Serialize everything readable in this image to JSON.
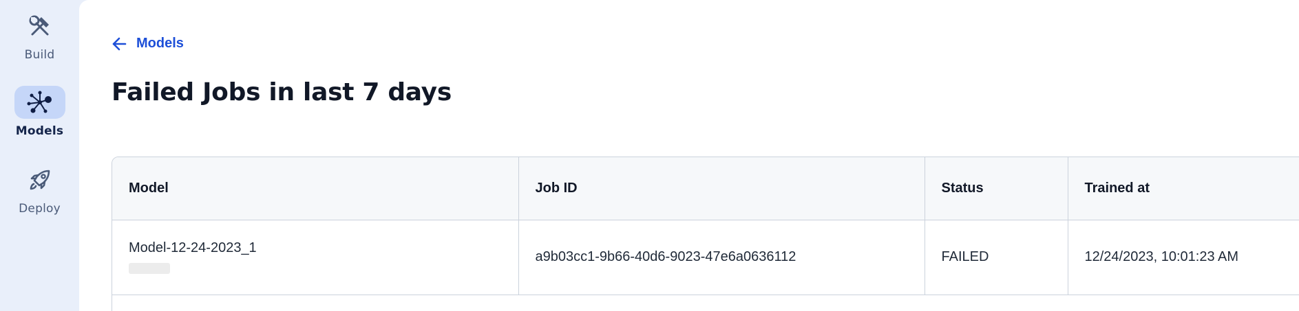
{
  "sidebar": {
    "items": [
      {
        "label": "Build",
        "icon": "hammer-wrench-icon",
        "active": false
      },
      {
        "label": "Models",
        "icon": "network-graph-icon",
        "active": true
      },
      {
        "label": "Deploy",
        "icon": "rocket-icon",
        "active": false
      }
    ]
  },
  "breadcrumb": {
    "back_label": "Models"
  },
  "page": {
    "title": "Failed Jobs in last 7 days"
  },
  "table": {
    "columns": [
      "Model",
      "Job ID",
      "Status",
      "Trained at"
    ],
    "rows": [
      {
        "model": "Model-12-24-2023_1",
        "job_id": "a9b03cc1-9b66-40d6-9023-47e6a0636112",
        "status": "FAILED",
        "trained_at": "12/24/2023, 10:01:23 AM"
      }
    ]
  },
  "colors": {
    "accent": "#1d4fd8",
    "sidebar_bg": "#e9effa",
    "active_nav_bg": "#c5d6f8"
  }
}
